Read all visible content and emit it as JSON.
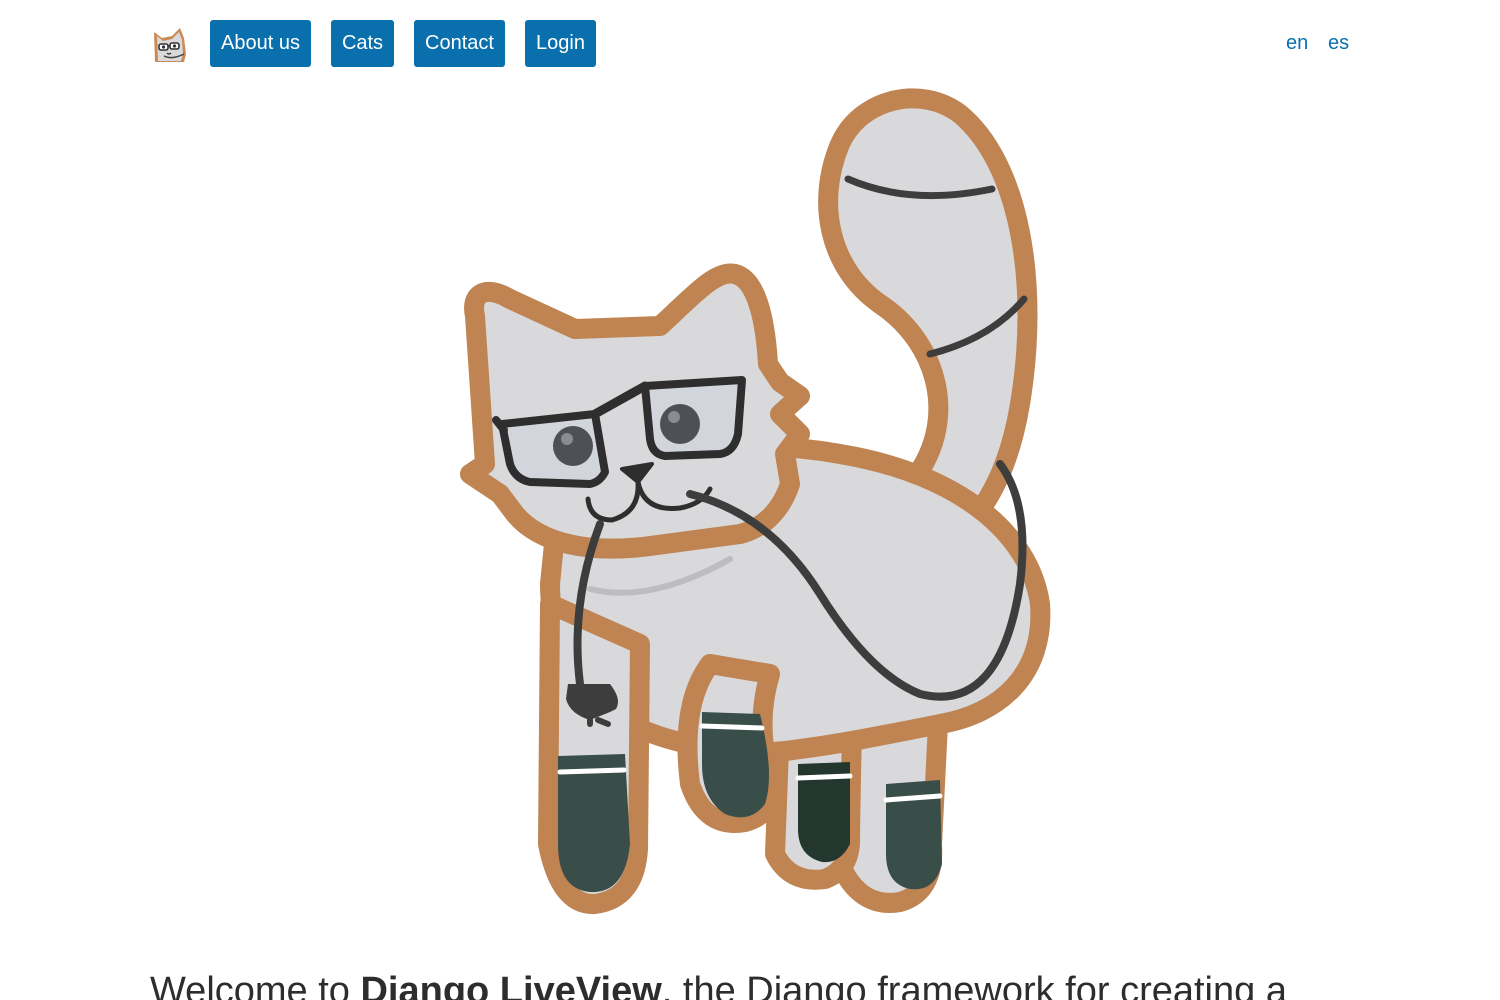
{
  "nav": {
    "logo_icon": "cat-logo-icon",
    "links": [
      {
        "label": "About us"
      },
      {
        "label": "Cats"
      },
      {
        "label": "Contact"
      },
      {
        "label": "Login"
      }
    ],
    "languages": [
      {
        "label": "en"
      },
      {
        "label": "es"
      }
    ],
    "button_color": "#0a70ad",
    "link_color": "#0a70ad"
  },
  "hero": {
    "image_icon": "glasses-cat-mascot-icon",
    "colors": {
      "outline": "#bf8452",
      "fur": "#d9d9db",
      "dark": "#3d3d3d",
      "socks": "#3a4e49"
    }
  },
  "intro": {
    "prefix": "Welcome to ",
    "product": "Django LiveView",
    "suffix": ", the Django framework for creating a"
  }
}
